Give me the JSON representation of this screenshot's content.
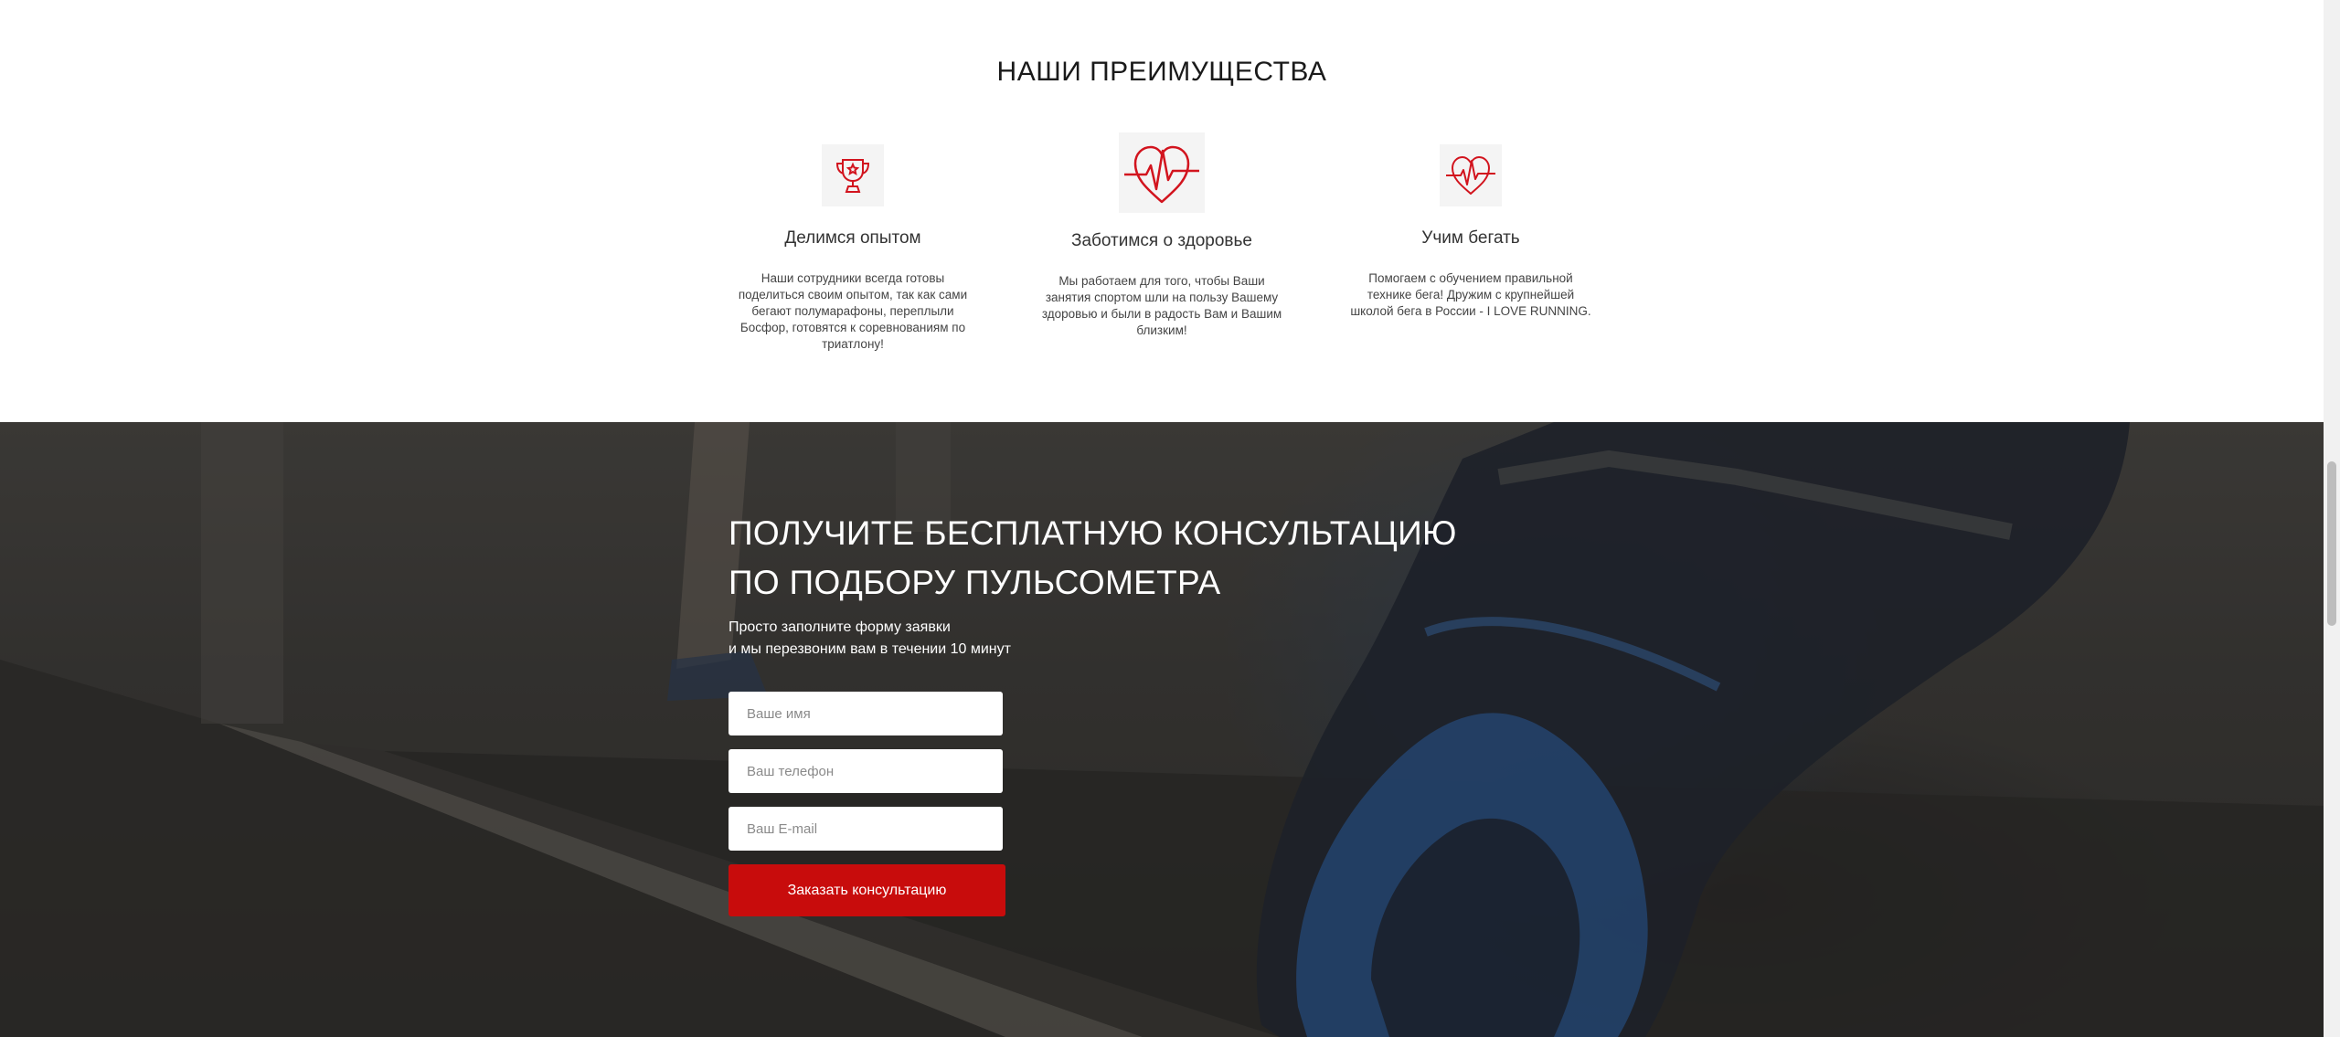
{
  "advantages": {
    "title": "НАШИ ПРЕИМУЩЕСТВА",
    "items": [
      {
        "icon": "trophy-icon",
        "title": "Делимся опытом",
        "text": "Наши сотрудники всегда готовы поделиться своим опытом, так как сами бегают полумарафоны, переплыли Босфор, готовятся к соревнованиям по триатлону!"
      },
      {
        "icon": "heartbeat-icon",
        "title": "Заботимся о здоровье",
        "text": "Мы работаем для того, чтобы Ваши занятия спортом шли на пользу Вашему здоровью и были в радость Вам и Вашим близким!"
      },
      {
        "icon": "heart-pulse-icon",
        "title": "Учим бегать",
        "text": "Помогаем с обучением правильной технике бега! Дружим с крупнейшей школой бега в России - I LOVE RUNNING."
      }
    ]
  },
  "consultation": {
    "title_line1": "ПОЛУЧИТЕ БЕСПЛАТНУЮ КОНСУЛЬТАЦИЮ",
    "title_line2": "ПО ПОДБОРУ ПУЛЬСОМЕТРА",
    "subtitle_line1": "Просто заполните форму заявки",
    "subtitle_line2": "и мы перезвоним вам в течении 10 минут",
    "form": {
      "name_placeholder": "Ваше имя",
      "phone_placeholder": "Ваш телефон",
      "email_placeholder": "Ваш E-mail",
      "submit_label": "Заказать консультацию"
    }
  },
  "colors": {
    "accent": "#c80c0c",
    "icon_red": "#d2141e",
    "dark_bg": "#3d3b39"
  }
}
